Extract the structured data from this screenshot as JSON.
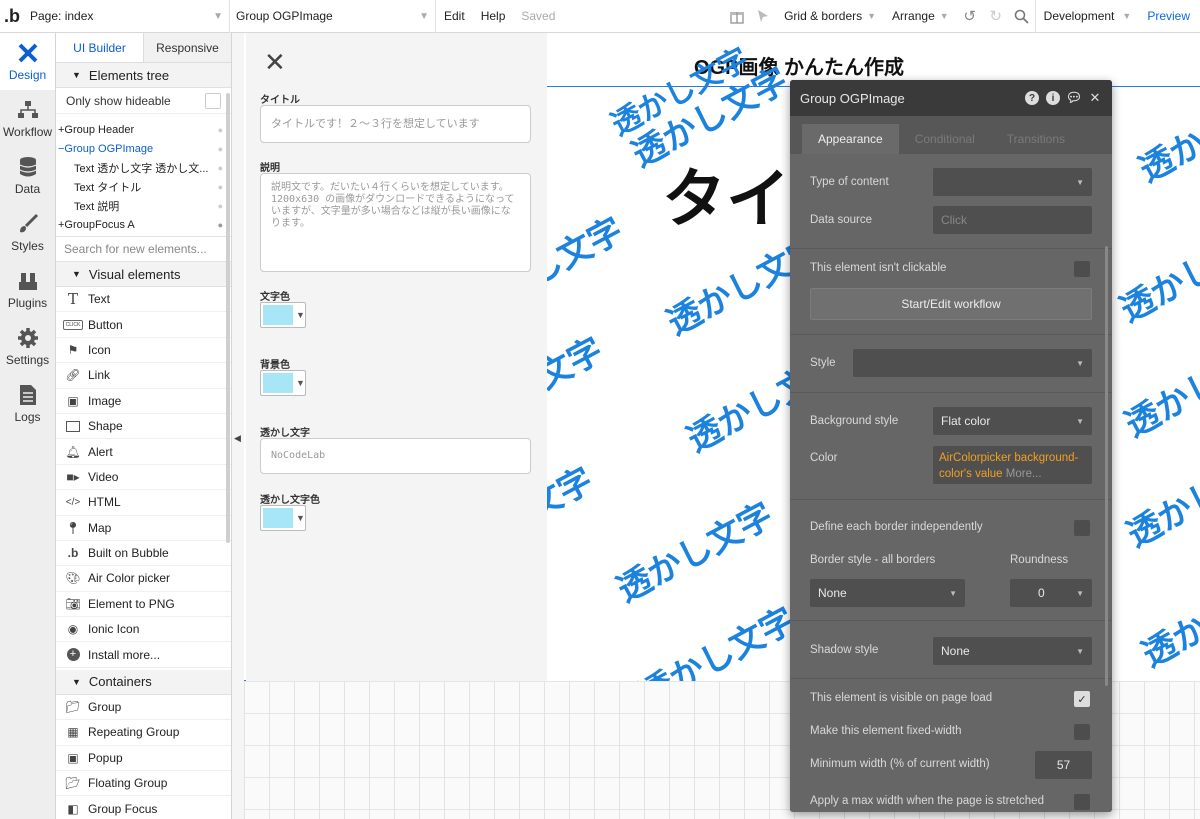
{
  "topbar": {
    "page_selector": "Page: index",
    "element_selector": "Group OGPImage",
    "edit": "Edit",
    "help": "Help",
    "saved": "Saved",
    "grid_borders": "Grid & borders",
    "arrange": "Arrange",
    "development": "Development",
    "preview": "Preview"
  },
  "rail": [
    {
      "label": "Design",
      "icon": "design-icon"
    },
    {
      "label": "Workflow",
      "icon": "workflow-icon"
    },
    {
      "label": "Data",
      "icon": "database-icon"
    },
    {
      "label": "Styles",
      "icon": "brush-icon"
    },
    {
      "label": "Plugins",
      "icon": "plug-icon"
    },
    {
      "label": "Settings",
      "icon": "gear-icon"
    },
    {
      "label": "Logs",
      "icon": "logs-icon"
    }
  ],
  "palette": {
    "tab_ui_builder": "UI Builder",
    "tab_responsive": "Responsive",
    "elements_tree": "Elements tree",
    "only_show_hideable": "Only show hideable",
    "tree": [
      {
        "label": "+Group Header",
        "indent": 0
      },
      {
        "label": "−Group OGPImage",
        "indent": 0,
        "selected": true
      },
      {
        "label": "Text 透かし文字 透かし文...",
        "indent": 1
      },
      {
        "label": "Text タイトル",
        "indent": 1
      },
      {
        "label": "Text 説明",
        "indent": 1
      },
      {
        "label": "+GroupFocus A",
        "indent": 0
      }
    ],
    "search_placeholder": "Search for new elements...",
    "visual_elements": "Visual elements",
    "visual": [
      "Text",
      "Button",
      "Icon",
      "Link",
      "Image",
      "Shape",
      "Alert",
      "Video",
      "HTML",
      "Map",
      "Built on Bubble",
      "Air Color picker",
      "Element to PNG",
      "Ionic Icon",
      "Install more..."
    ],
    "button_icon_text": "CLICK",
    "containers": "Containers",
    "container_items": [
      "Group",
      "Repeating Group",
      "Popup",
      "Floating Group",
      "Group Focus"
    ]
  },
  "form": {
    "title_label": "タイトル",
    "title_placeholder": "タイトルです！２〜３行を想定しています",
    "desc_label": "説明",
    "desc_placeholder": "説明文です。だいたい４行くらいを想定しています。\n1200x630 の画像がダウンロードできるようになっていますが、文字量が多い場合などは縦が長い画像になります。",
    "text_color_label": "文字色",
    "bg_color_label": "背景色",
    "watermark_label": "透かし文字",
    "watermark_placeholder": "NoCodeLab",
    "watermark_color_label": "透かし文字色",
    "swatch_color": "#a6e6f7"
  },
  "preview": {
    "title": "OGP画像 かんたん作成",
    "big_title": "タイ",
    "watermark": "透かし文字",
    "watermark_color": "#1b82de"
  },
  "props": {
    "title": "Group OGPImage",
    "tabs": [
      "Appearance",
      "Conditional",
      "Transitions"
    ],
    "type_of_content": "Type of content",
    "data_source": "Data source",
    "data_source_placeholder": "Click",
    "not_clickable": "This element isn't clickable",
    "workflow_btn": "Start/Edit workflow",
    "style": "Style",
    "background_style": "Background style",
    "background_value": "Flat color",
    "color": "Color",
    "color_expr_1": "AirColorpicker background-",
    "color_expr_2": "color's value",
    "color_more": "More...",
    "border_each": "Define each border independently",
    "border_style": "Border style - all borders",
    "roundness": "Roundness",
    "border_value": "None",
    "roundness_value": "0",
    "shadow_style": "Shadow style",
    "shadow_value": "None",
    "visible_on_load": "This element is visible on page load",
    "fixed_width": "Make this element fixed-width",
    "min_width": "Minimum width (% of current width)",
    "min_width_value": "57",
    "max_width": "Apply a max width when the page is stretched"
  }
}
